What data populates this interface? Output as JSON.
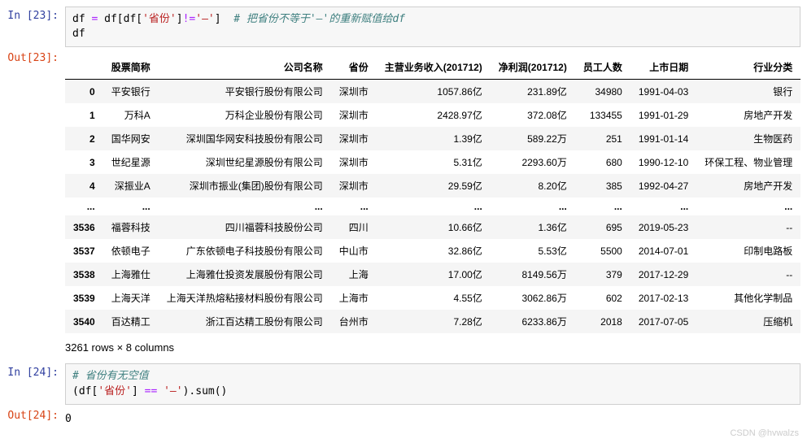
{
  "cells": {
    "c1": {
      "in_label": "In [23]:",
      "out_label": "Out[23]:",
      "code": {
        "line1_var": "df ",
        "line1_eq": "= ",
        "line1_expr1": "df[df[",
        "line1_str1": "'省份'",
        "line1_expr2": "]",
        "line1_neq": "!=",
        "line1_str2": "'—'",
        "line1_expr3": "]  ",
        "line1_comment": "# 把省份不等于'—'的重新赋值给df",
        "line2": "df"
      },
      "table": {
        "headers": [
          "",
          "股票简称",
          "公司名称",
          "省份",
          "主营业务收入(201712)",
          "净利润(201712)",
          "员工人数",
          "上市日期",
          "行业分类"
        ],
        "rows": [
          {
            "idx": "0",
            "cells": [
              "平安银行",
              "平安银行股份有限公司",
              "深圳市",
              "1057.86亿",
              "231.89亿",
              "34980",
              "1991-04-03",
              "银行"
            ]
          },
          {
            "idx": "1",
            "cells": [
              "万科A",
              "万科企业股份有限公司",
              "深圳市",
              "2428.97亿",
              "372.08亿",
              "133455",
              "1991-01-29",
              "房地产开发"
            ]
          },
          {
            "idx": "2",
            "cells": [
              "国华网安",
              "深圳国华网安科技股份有限公司",
              "深圳市",
              "1.39亿",
              "589.22万",
              "251",
              "1991-01-14",
              "生物医药"
            ]
          },
          {
            "idx": "3",
            "cells": [
              "世纪星源",
              "深圳世纪星源股份有限公司",
              "深圳市",
              "5.31亿",
              "2293.60万",
              "680",
              "1990-12-10",
              "环保工程、物业管理"
            ]
          },
          {
            "idx": "4",
            "cells": [
              "深振业A",
              "深圳市振业(集团)股份有限公司",
              "深圳市",
              "29.59亿",
              "8.20亿",
              "385",
              "1992-04-27",
              "房地产开发"
            ]
          },
          {
            "idx": "...",
            "cells": [
              "...",
              "...",
              "...",
              "...",
              "...",
              "...",
              "...",
              "..."
            ]
          },
          {
            "idx": "3536",
            "cells": [
              "福蓉科技",
              "四川福蓉科技股份公司",
              "四川",
              "10.66亿",
              "1.36亿",
              "695",
              "2019-05-23",
              "--"
            ]
          },
          {
            "idx": "3537",
            "cells": [
              "依顿电子",
              "广东依顿电子科技股份有限公司",
              "中山市",
              "32.86亿",
              "5.53亿",
              "5500",
              "2014-07-01",
              "印制电路板"
            ]
          },
          {
            "idx": "3538",
            "cells": [
              "上海雅仕",
              "上海雅仕投资发展股份有限公司",
              "上海",
              "17.00亿",
              "8149.56万",
              "379",
              "2017-12-29",
              "--"
            ]
          },
          {
            "idx": "3539",
            "cells": [
              "上海天洋",
              "上海天洋热熔粘接材料股份有限公司",
              "上海市",
              "4.55亿",
              "3062.86万",
              "602",
              "2017-02-13",
              "其他化学制品"
            ]
          },
          {
            "idx": "3540",
            "cells": [
              "百达精工",
              "浙江百达精工股份有限公司",
              "台州市",
              "7.28亿",
              "6233.86万",
              "2018",
              "2017-07-05",
              "压缩机"
            ]
          }
        ],
        "shape": "3261 rows × 8 columns"
      }
    },
    "c2": {
      "in_label": "In [24]:",
      "out_label": "Out[24]:",
      "code": {
        "line1_comment": "# 省份有无空值",
        "line2_p1": "(df[",
        "line2_str1": "'省份'",
        "line2_p2": "] ",
        "line2_eq": "== ",
        "line2_str2": "'—'",
        "line2_p3": ").sum()"
      },
      "output": "0"
    }
  },
  "watermark": "CSDN @hvwalzs"
}
